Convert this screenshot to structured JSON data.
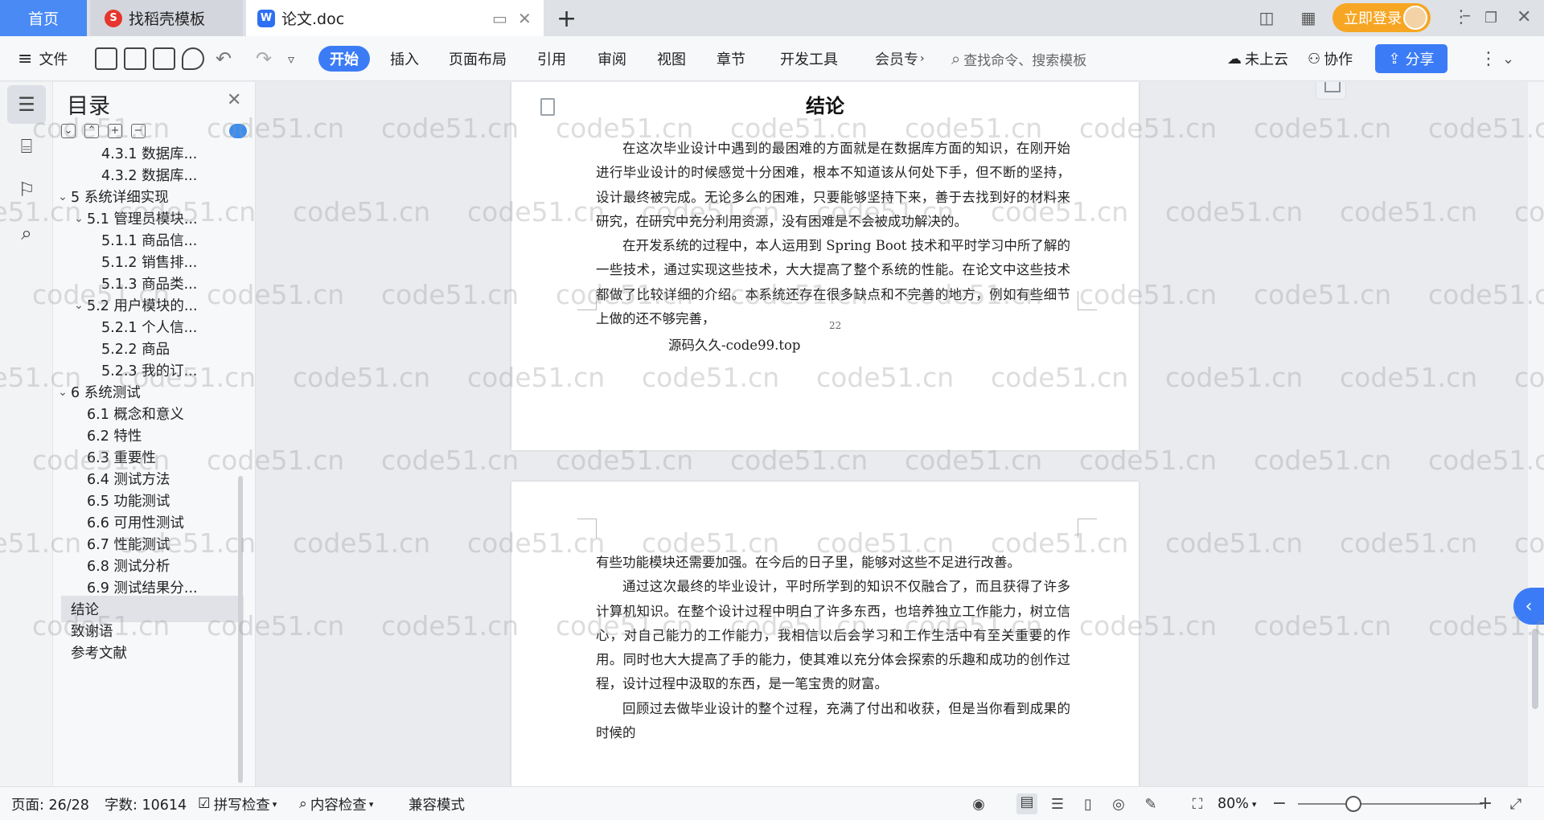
{
  "titlebar": {
    "home_tab": "首页",
    "tabs": [
      {
        "label": "找稻壳模板",
        "icon": "daoke-icon"
      },
      {
        "label": "论文.doc",
        "icon": "wps-writer-icon"
      }
    ],
    "login_label": "立即登录"
  },
  "ribbon": {
    "file_menu": "文件",
    "tabs": [
      "开始",
      "插入",
      "页面布局",
      "引用",
      "审阅",
      "视图",
      "章节",
      "开发工具",
      "会员专"
    ],
    "search_placeholder": "查找命令、搜索模板",
    "cloud_status": "未上云",
    "collab": "协作",
    "share": "分享"
  },
  "toc": {
    "title": "目录",
    "items": [
      {
        "label": "4.3.1 数据库...",
        "level": 3
      },
      {
        "label": "4.3.2 数据库...",
        "level": 3
      },
      {
        "label": "5 系统详细实现",
        "level": 1,
        "expanded": true
      },
      {
        "label": "5.1  管理员模块...",
        "level": 2,
        "expanded": true
      },
      {
        "label": "5.1.1  商品信...",
        "level": 3
      },
      {
        "label": "5.1.2  销售排...",
        "level": 3
      },
      {
        "label": "5.1.3  商品类...",
        "level": 3
      },
      {
        "label": "5.2  用户模块的...",
        "level": 2,
        "expanded": true
      },
      {
        "label": "5.2.1  个人信...",
        "level": 3
      },
      {
        "label": "5.2.2  商品",
        "level": 3
      },
      {
        "label": "5.2.3  我的订...",
        "level": 3
      },
      {
        "label": "6 系统测试",
        "level": 1,
        "expanded": true
      },
      {
        "label": "6.1 概念和意义",
        "level": 2
      },
      {
        "label": "6.2 特性",
        "level": 2
      },
      {
        "label": "6.3 重要性",
        "level": 2
      },
      {
        "label": "6.4 测试方法",
        "level": 2
      },
      {
        "label": "6.5  功能测试",
        "level": 2
      },
      {
        "label": "6.6 可用性测试",
        "level": 2
      },
      {
        "label": "6.7 性能测试",
        "level": 2
      },
      {
        "label": "6.8 测试分析",
        "level": 2
      },
      {
        "label": "6.9 测试结果分...",
        "level": 2
      },
      {
        "label": "结论",
        "level": 1,
        "selected": true
      },
      {
        "label": "致谢语",
        "level": 1
      },
      {
        "label": "参考文献",
        "level": 1
      }
    ]
  },
  "document": {
    "heading": "结论",
    "page1_paragraphs": [
      "在这次毕业设计中遇到的最困难的方面就是在数据库方面的知识，在刚开始进行毕业设计的时候感觉十分困难，根本不知道该从何处下手，但不断的坚持，设计最终被完成。无论多么的困难，只要能够坚持下来，善于去找到好的材料来研究，在研究中充分利用资源，没有困难是不会被成功解决的。",
      "在开发系统的过程中，本人运用到 Spring Boot 技术和平时学习中所了解的一些技术，通过实现这些技术，大大提高了整个系统的性能。在论文中这些技术都做了比较详细的介绍。本系统还存在很多缺点和不完善的地方，例如有些细节上做的还不够完善，"
    ],
    "page_number": "22",
    "footer": "源码久久-code99.top",
    "page2_paragraphs": [
      "有些功能模块还需要加强。在今后的日子里，能够对这些不足进行改善。",
      "通过这次最终的毕业设计，平时所学到的知识不仅融合了，而且获得了许多计算机知识。在整个设计过程中明白了许多东西，也培养独立工作能力，树立信心，对自己能力的工作能力，我相信以后会学习和工作生活中有至关重要的作用。同时也大大提高了手的能力，使其难以充分体会探索的乐趣和成功的创作过程，设计过程中汲取的东西，是一笔宝贵的财富。",
      "回顾过去做毕业设计的整个过程，充满了付出和收获，但是当你看到成果的时候的"
    ],
    "watermark": "code51.cn"
  },
  "statusbar": {
    "page": "页面: 26/28",
    "words": "字数: 10614",
    "spell": "拼写检查",
    "content_check": "内容检查",
    "compat": "兼容模式",
    "zoom": "80%",
    "zoom_level": 0.3
  }
}
